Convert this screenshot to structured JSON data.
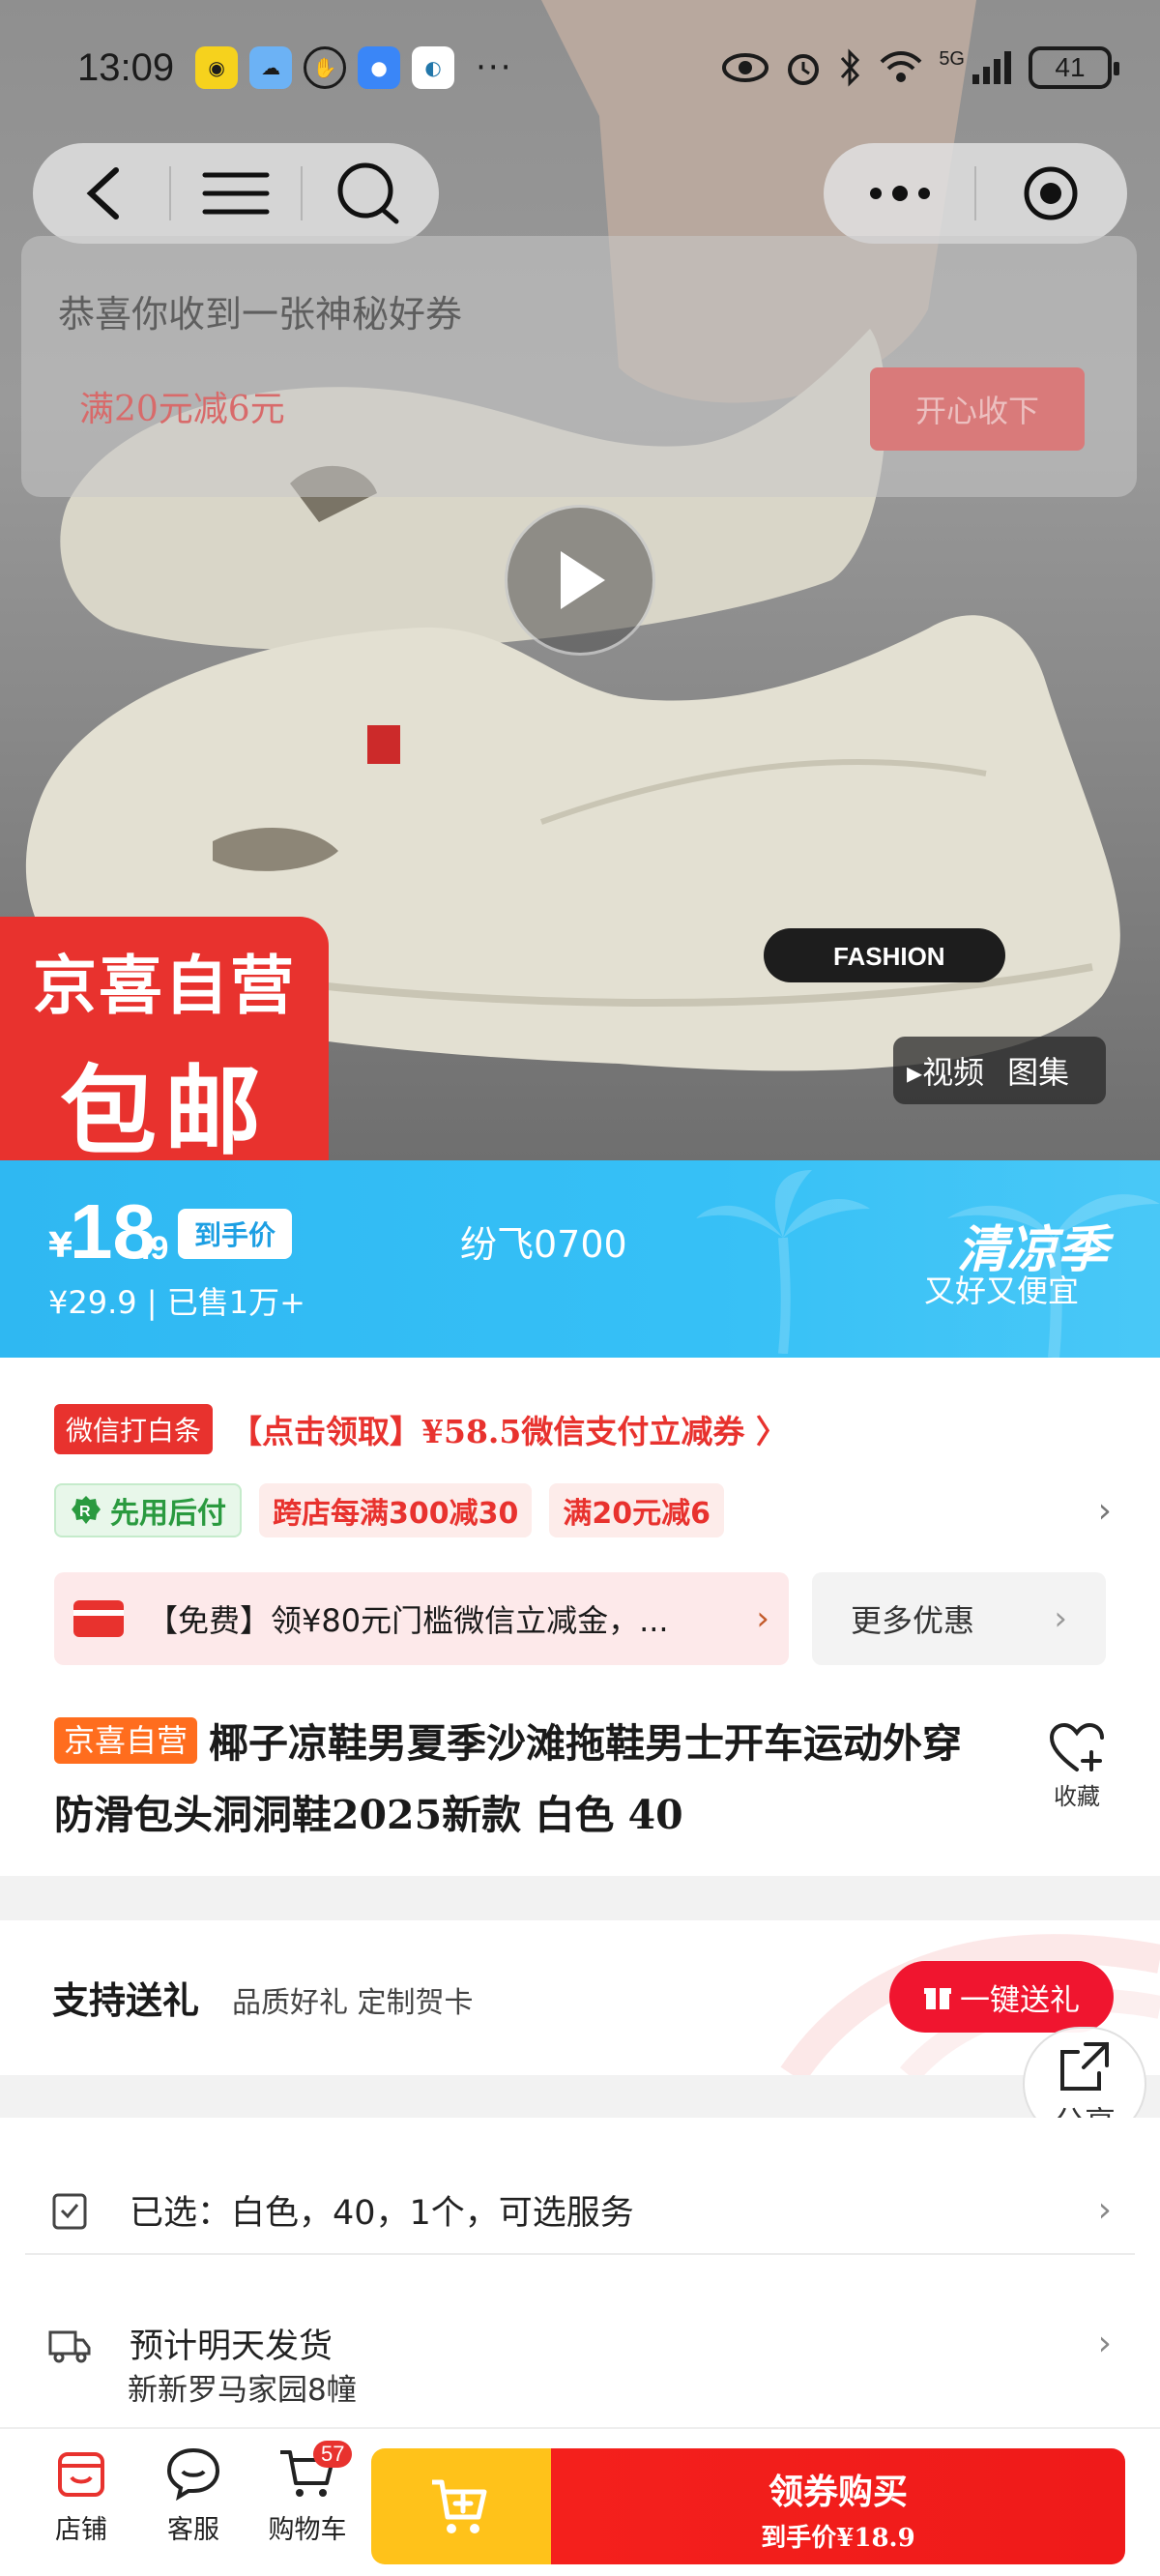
{
  "status_bar": {
    "time": "13:09",
    "more": "···",
    "network": "5G",
    "battery": "41"
  },
  "nav": {
    "back_icon": "chevron-left-icon",
    "menu_icon": "menu-icon",
    "search_icon": "search-icon",
    "more_icon": "more-dots-icon",
    "record_icon": "target-icon"
  },
  "coupon_popup": {
    "title": "恭喜你收到一张神秘好券",
    "amount": "满20元减6元",
    "button": "开心收下"
  },
  "hero": {
    "badge_line1": "京喜自营",
    "badge_line2": "包邮",
    "tab_video": "▸视频",
    "tab_gallery": "图集",
    "shoe_label": "FASHION"
  },
  "price": {
    "symbol": "¥",
    "integer": "18",
    "decimal": ".9",
    "tag": "到手价",
    "sub": "¥29.9 | 已售1万+",
    "center": "纷飞0700",
    "season_title": "清凉季",
    "season_sub": "又好又便宜"
  },
  "promo": {
    "wx_tag": "微信打白条",
    "wx_text": "【点击领取】¥58.5微信支付立减券 〉",
    "chips": [
      "先用后付",
      "跨店每满300减30",
      "满20元减6"
    ],
    "pay_card_text": "【免费】领¥80元门槛微信立减金，...",
    "more_deals": "更多优惠"
  },
  "product": {
    "self_tag": "京喜自营",
    "title": "椰子凉鞋男夏季沙滩拖鞋男士开车运动外穿防滑包头洞洞鞋2025新款 白色 40",
    "fav_label": "收藏"
  },
  "gift": {
    "title": "支持送礼",
    "sub": "品质好礼 定制贺卡",
    "button": "一键送礼",
    "share": "分享"
  },
  "options": {
    "selected": "已选：白色，40，1个，可选服务",
    "ship_title": "预计明天发货",
    "ship_addr": "新新罗马家园8幢"
  },
  "bottom": {
    "store": "店铺",
    "service": "客服",
    "cart": "购物车",
    "cart_count": "57",
    "buy_title": "领券购买",
    "buy_sub": "到手价¥18.9"
  },
  "colors": {
    "brand_red": "#e8322e",
    "price_blue": "#2fb8f2",
    "cart_yellow": "#ffc21a"
  }
}
